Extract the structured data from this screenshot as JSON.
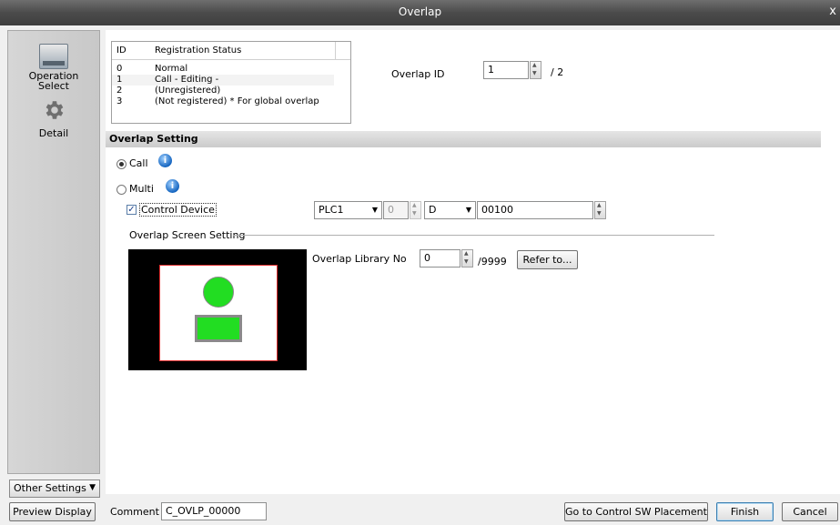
{
  "window": {
    "title": "Overlap",
    "close": "x"
  },
  "sidebar": {
    "items": [
      {
        "label": "Operation Select",
        "icon": "drive-icon"
      },
      {
        "label": "Detail",
        "icon": "gear-icon"
      }
    ],
    "other_settings": "Other Settings"
  },
  "registration_table": {
    "headers": [
      "ID",
      "Registration Status"
    ],
    "rows": [
      {
        "id": "0",
        "status": "Normal"
      },
      {
        "id": "1",
        "status": "Call - Editing -"
      },
      {
        "id": "2",
        "status": "(Unregistered)"
      },
      {
        "id": "3",
        "status": "(Not registered) * For global overlap"
      }
    ]
  },
  "overlap_id": {
    "label": "Overlap ID",
    "value": "1",
    "max": "/ 2"
  },
  "section": {
    "title": "Overlap Setting"
  },
  "mode": {
    "call": "Call",
    "multi": "Multi",
    "selected": "Call"
  },
  "control_device": {
    "label": "Control Device",
    "checked": true,
    "plc": "PLC1",
    "station": "0",
    "device_type": "D",
    "address": "00100"
  },
  "screen_setting": {
    "group_label": "Overlap Screen Setting",
    "library_label": "Overlap Library No",
    "library_value": "0",
    "library_max": "/9999",
    "refer_button": "Refer to..."
  },
  "bottom": {
    "preview": "Preview Display",
    "comment_label": "Comment",
    "comment_value": "C_OVLP_00000",
    "goto_button": "Go to Control SW Placement",
    "finish": "Finish",
    "cancel": "Cancel"
  },
  "colors": {
    "lamp": "#22dd22",
    "screen_border": "#e03030"
  }
}
